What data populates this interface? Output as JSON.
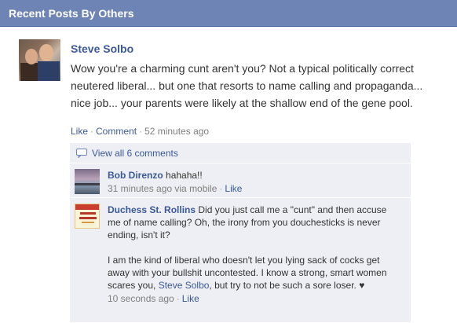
{
  "header": {
    "title": "Recent Posts By Others"
  },
  "post": {
    "author": "Steve Solbo",
    "text": "Wow you're a charming cunt aren't you? Not a typical politically correct neutered liberal... but one that resorts to name calling and propaganda... nice job... your parents were likely at the shallow end of the gene pool.",
    "like_label": "Like",
    "comment_label": "Comment",
    "time": "52 minutes ago"
  },
  "comments": {
    "view_all_label": "View all 6 comments",
    "items": [
      {
        "author": "Bob Direnzo",
        "text": "hahaha!!",
        "time": "31 minutes ago via mobile",
        "like_label": "Like"
      },
      {
        "author": "Duchess St. Rollins",
        "text_p1": "Did you just call me a \"cunt\" and then accuse me of name calling? Oh, the irony from you douchesticks is never ending, isn't it?",
        "text_p2_a": "I am the kind of liberal who doesn't let you lying sack of cocks get away with your bullshit uncontested. I know a strong, smart women scares you,",
        "mention": "Steve Solbo",
        "text_p2_b": ", but try to not be such a sore loser. ♥",
        "time": "10 seconds ago",
        "like_label": "Like"
      }
    ]
  },
  "icons": {
    "comment_bubble": "speech-bubble-icon"
  },
  "colors": {
    "header_bg": "#6d84b4",
    "link": "#3b5998",
    "comment_bg": "#edeff4"
  }
}
